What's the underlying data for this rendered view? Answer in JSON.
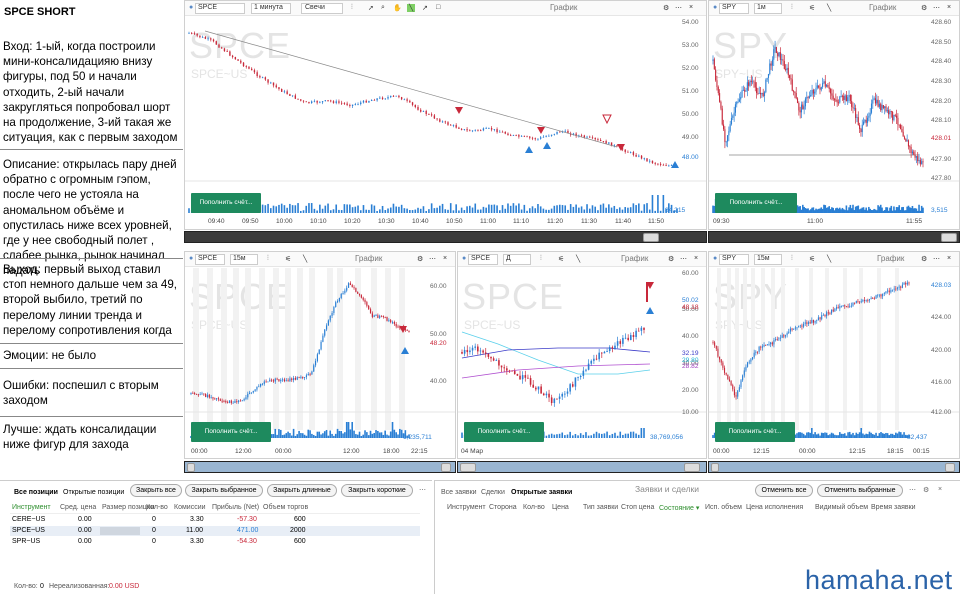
{
  "notes": {
    "title": "SPCE SHORT",
    "entry": "Вход: 1-ый, когда построили мини-консалидацияю внизу фигуры, под 50 и начали отходить, 2-ый начали закругляться попробовал шорт на продолжение, 3-ий такая же ситуация, как с первым заходом",
    "description": "Описание: открылась пару дней обратно с огромным гэпом, после чего не устояла на аномальном объёме и опустилась ниже всех уровней, где у нее свободный полет , слабее рынка, рынок начинал падать",
    "exit": "Выход: первый выход ставил стоп немного дальше чем за 49, второй выбило, третий по перелому линии тренда и перелому сопротивления когда",
    "emotions": "Эмоции: не было",
    "mistakes": "Ошибки: поспешил с вторым заходом",
    "better": "Лучше: ждать консалидации ниже фигур для захода"
  },
  "topup_label": "Пополнить счёт...",
  "chart_label": "График",
  "charts": {
    "c1": {
      "symbol": "SPCE",
      "interval": "1 минута",
      "type": "Свечи",
      "wm": "SPCE",
      "wm2": "SPCE~US",
      "y": [
        "54.00",
        "53.00",
        "52.00",
        "51.00",
        "50.00",
        "49.00",
        "48.00"
      ],
      "price": "48.00",
      "x": [
        "09:40",
        "09:50",
        "10:00",
        "10:10",
        "10:20",
        "10:30",
        "10:40",
        "10:50",
        "11:00",
        "11:10",
        "11:20",
        "11:30",
        "11:40",
        "11:50"
      ],
      "vol": "84,215"
    },
    "c2": {
      "symbol": "SPY",
      "interval": "1м",
      "wm": "SPY",
      "wm2": "SPY~US",
      "y": [
        "428.60",
        "428.50",
        "428.40",
        "428.30",
        "428.20",
        "428.10",
        "427.90",
        "427.80"
      ],
      "price": "428.01",
      "x": [
        "09:30",
        "11:00",
        "11:55"
      ],
      "vol": "3,515"
    },
    "c3": {
      "symbol": "SPCE",
      "interval": "15м",
      "wm": "SPCE",
      "wm2": "SPCE~US",
      "y": [
        "60.00",
        "50.00",
        "40.00"
      ],
      "price": "48.20",
      "x": [
        "00:00",
        "12:00",
        "00:00",
        "12:00",
        "18:00",
        "22:15"
      ],
      "vol": "1,235,711"
    },
    "c4": {
      "symbol": "SPCE",
      "interval": "Д",
      "wm": "SPCE",
      "wm2": "SPCE~US",
      "y": [
        "60.00",
        "50.00",
        "40.00",
        "30.00",
        "20.00",
        "10.00"
      ],
      "p1": "50.02",
      "p2": "48.18",
      "p3": "32.19",
      "p4": "29.80",
      "p5": "28.82",
      "x": [
        "04 Мар"
      ],
      "vol": "38,769,056"
    },
    "c5": {
      "symbol": "SPY",
      "interval": "15м",
      "wm": "SPY",
      "wm2": "SPY~US",
      "y": [
        "428.00",
        "424.00",
        "420.00",
        "416.00",
        "412.00"
      ],
      "price": "428.03",
      "x": [
        "00:00",
        "12:15",
        "00:00",
        "12:15",
        "18:15",
        "00:15"
      ],
      "vol": "82,437"
    }
  },
  "positions": {
    "tabs": [
      "Все позиции",
      "Открытые позиции"
    ],
    "buttons": [
      "Закрыть все",
      "Закрыть выбранное",
      "Закрыть длинные",
      "Закрыть короткие"
    ],
    "headers": [
      "Инструмент",
      "Сред. цена",
      "Размер позиции",
      "Кол-во",
      "Комиссии",
      "Прибыль (Net)",
      "Объем торгов"
    ],
    "rows": [
      {
        "inst": "CERE~US",
        "avg": "0.00",
        "size": "",
        "qty": "0",
        "comm": "3.30",
        "pnl": "-57.30",
        "vol": "600"
      },
      {
        "inst": "SPCE~US",
        "avg": "0.00",
        "size": "",
        "qty": "0",
        "comm": "11.00",
        "pnl": "471.00",
        "vol": "2000"
      },
      {
        "inst": "SPR~US",
        "avg": "0.00",
        "size": "",
        "qty": "0",
        "comm": "3.30",
        "pnl": "-54.30",
        "vol": "600"
      }
    ],
    "footer_qty_label": "Кол-во:",
    "footer_qty": "0",
    "footer_unreal_label": "Нереализованная:",
    "footer_unreal": "0.00 USD"
  },
  "orders": {
    "tabs": [
      "Все заявки",
      "Сделки",
      "Открытые заявки"
    ],
    "title": "Заявки и сделки",
    "buttons": [
      "Отменить все",
      "Отменить выбранные"
    ],
    "headers": [
      "Инструмент",
      "Сторона",
      "Кол-во",
      "Цена",
      "Тип заявки",
      "Стоп цена",
      "Состояние ▾",
      "Исп. объем",
      "Цена исполнения",
      "Видимый объем",
      "Время заявки"
    ]
  },
  "watermark": "hamaha.net",
  "colors": {
    "up": "#2a7fd4",
    "down": "#c8283a",
    "signal_up": "#2a7fd4",
    "signal_down": "#c8283a",
    "topup": "#1e8a5e"
  }
}
